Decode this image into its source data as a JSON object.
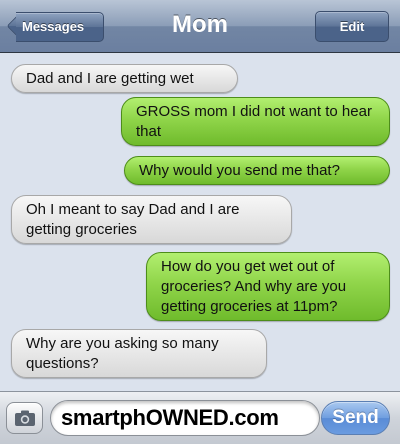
{
  "nav": {
    "back_label": "Messages",
    "title": "Mom",
    "edit_label": "Edit"
  },
  "messages": [
    {
      "direction": "incoming",
      "text": "Dad and I are getting wet"
    },
    {
      "direction": "outgoing",
      "text": "GROSS mom I did not want to hear that"
    },
    {
      "direction": "outgoing",
      "text": "Why would you send me that?"
    },
    {
      "direction": "incoming",
      "text": "Oh I meant to say Dad and I are getting groceries"
    },
    {
      "direction": "outgoing",
      "text": "How do you get wet out of groceries? And why are you getting groceries at 11pm?"
    },
    {
      "direction": "incoming",
      "text": "Why are you asking so many questions?"
    }
  ],
  "composer": {
    "text_value": "smartphOWNED.com",
    "send_label": "Send"
  },
  "colors": {
    "incoming_bubble": "#e6e6e6",
    "outgoing_bubble": "#8fd44b",
    "navbar": "#7b8fad",
    "send_button": "#6a9be0"
  },
  "icons": {
    "back": "back-arrow-icon",
    "camera": "camera-icon"
  }
}
